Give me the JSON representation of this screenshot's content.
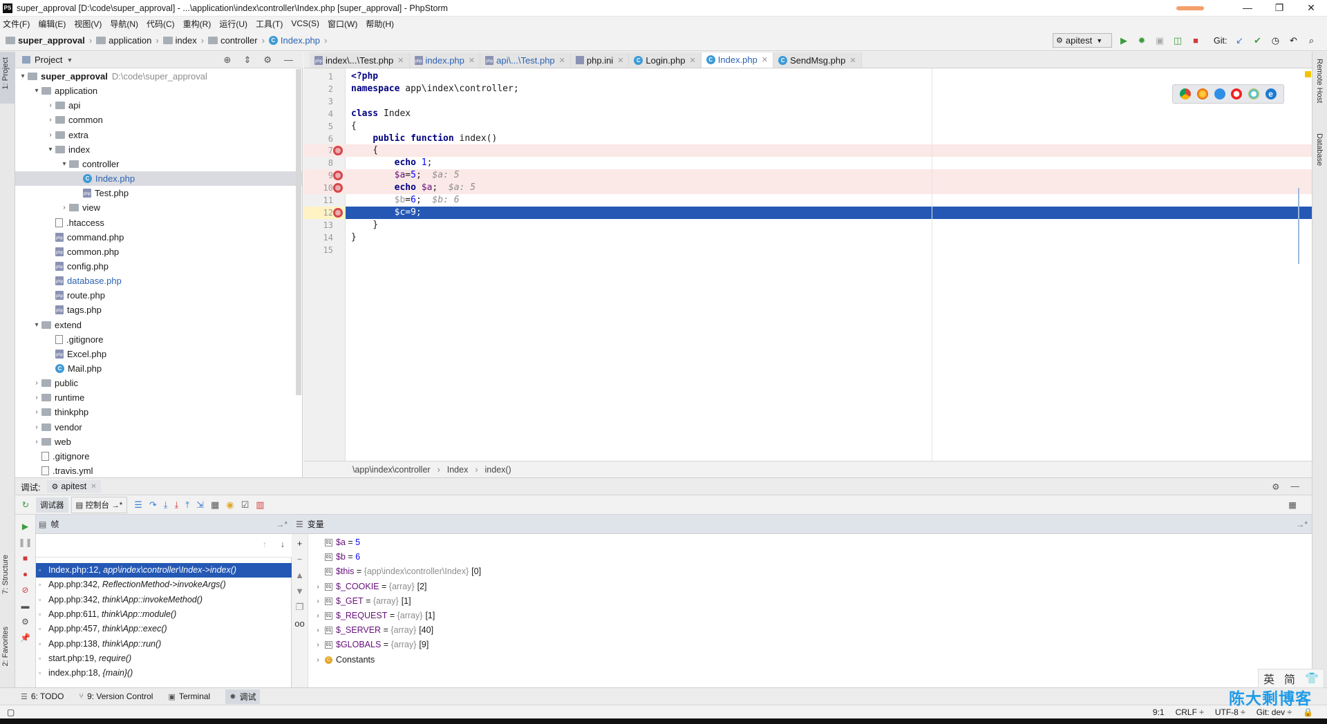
{
  "window": {
    "title": "super_approval [D:\\code\\super_approval] - ...\\application\\index\\controller\\Index.php [super_approval] - PhpStorm",
    "logo": "PS",
    "controls": [
      "—",
      "❐",
      "✕"
    ]
  },
  "menu": [
    "文件(F)",
    "编辑(E)",
    "视图(V)",
    "导航(N)",
    "代码(C)",
    "重构(R)",
    "运行(U)",
    "工具(T)",
    "VCS(S)",
    "窗口(W)",
    "帮助(H)"
  ],
  "breadcrumbs": [
    "super_approval",
    "application",
    "index",
    "controller",
    "Index.php"
  ],
  "toolbar": {
    "run_config": "apitest",
    "git_label": "Git:"
  },
  "left_strip": {
    "project": "1: Project",
    "structure": "7: Structure",
    "favorites": "2: Favorites"
  },
  "right_strip": {
    "remote": "Remote Host",
    "database": "Database"
  },
  "project": {
    "title": "Project",
    "tree": [
      {
        "label": "super_approval",
        "path": "D:\\code\\super_approval",
        "indent": 0,
        "type": "folder",
        "arrow": "open",
        "bold": true
      },
      {
        "label": "application",
        "indent": 1,
        "type": "folder",
        "arrow": "open"
      },
      {
        "label": "api",
        "indent": 2,
        "type": "folder",
        "arrow": "closed"
      },
      {
        "label": "common",
        "indent": 2,
        "type": "folder",
        "arrow": "closed"
      },
      {
        "label": "extra",
        "indent": 2,
        "type": "folder",
        "arrow": "closed"
      },
      {
        "label": "index",
        "indent": 2,
        "type": "folder",
        "arrow": "open"
      },
      {
        "label": "controller",
        "indent": 3,
        "type": "folder",
        "arrow": "open"
      },
      {
        "label": "Index.php",
        "indent": 4,
        "type": "class",
        "selected": true,
        "blue": true
      },
      {
        "label": "Test.php",
        "indent": 4,
        "type": "php"
      },
      {
        "label": "view",
        "indent": 3,
        "type": "folder",
        "arrow": "closed"
      },
      {
        "label": ".htaccess",
        "indent": 2,
        "type": "file"
      },
      {
        "label": "command.php",
        "indent": 2,
        "type": "php"
      },
      {
        "label": "common.php",
        "indent": 2,
        "type": "php"
      },
      {
        "label": "config.php",
        "indent": 2,
        "type": "php"
      },
      {
        "label": "database.php",
        "indent": 2,
        "type": "php",
        "blue": true
      },
      {
        "label": "route.php",
        "indent": 2,
        "type": "php"
      },
      {
        "label": "tags.php",
        "indent": 2,
        "type": "php"
      },
      {
        "label": "extend",
        "indent": 1,
        "type": "folder",
        "arrow": "open"
      },
      {
        "label": ".gitignore",
        "indent": 2,
        "type": "file"
      },
      {
        "label": "Excel.php",
        "indent": 2,
        "type": "php"
      },
      {
        "label": "Mail.php",
        "indent": 2,
        "type": "class"
      },
      {
        "label": "public",
        "indent": 1,
        "type": "folder",
        "arrow": "closed"
      },
      {
        "label": "runtime",
        "indent": 1,
        "type": "folder",
        "arrow": "closed"
      },
      {
        "label": "thinkphp",
        "indent": 1,
        "type": "folder",
        "arrow": "closed"
      },
      {
        "label": "vendor",
        "indent": 1,
        "type": "folder",
        "arrow": "closed"
      },
      {
        "label": "web",
        "indent": 1,
        "type": "folder",
        "arrow": "closed"
      },
      {
        "label": ".gitignore",
        "indent": 1,
        "type": "file"
      },
      {
        "label": ".travis.yml",
        "indent": 1,
        "type": "file"
      }
    ]
  },
  "tabs": [
    {
      "label": "index\\...\\Test.php",
      "type": "php"
    },
    {
      "label": "index.php",
      "type": "php",
      "blue": true
    },
    {
      "label": "api\\...\\Test.php",
      "type": "php",
      "blue": true
    },
    {
      "label": "php.ini",
      "type": "ini"
    },
    {
      "label": "Login.php",
      "type": "class"
    },
    {
      "label": "Index.php",
      "type": "class",
      "active": true,
      "blue": true
    },
    {
      "label": "SendMsg.php",
      "type": "class"
    }
  ],
  "code": [
    {
      "n": "1",
      "html": "<span class='kw'>&lt;?php</span>"
    },
    {
      "n": "2",
      "html": "<span class='kw'>namespace</span> app\\index\\controller;"
    },
    {
      "n": "3",
      "html": ""
    },
    {
      "n": "4",
      "html": "<span class='kw'>class</span> Index"
    },
    {
      "n": "5",
      "html": "{"
    },
    {
      "n": "6",
      "html": "    <span class='kw'>public function</span> index()"
    },
    {
      "n": "7",
      "html": "    {",
      "bp": true,
      "hl": "bp"
    },
    {
      "n": "8",
      "html": "        <span class='kw'>echo</span> <span class='num'>1</span>;"
    },
    {
      "n": "9",
      "html": "        <span class='var'>$a</span>=<span class='num'>5</span>;  <span class='hint'>$a: 5</span>",
      "bp": true,
      "hl": "bp"
    },
    {
      "n": "10",
      "html": "        <span class='kw'>echo</span> <span class='var'>$a</span>;  <span class='hint'>$a: 5</span>",
      "bp": true,
      "hl": "bp"
    },
    {
      "n": "11",
      "html": "        <span style='color:#999'>$b</span>=<span class='num'>6</span>;  <span class='hint'>$b: 6</span>"
    },
    {
      "n": "12",
      "html": "        $c=9;",
      "bp": true,
      "hl": "exec"
    },
    {
      "n": "13",
      "html": "    }"
    },
    {
      "n": "14",
      "html": "}"
    },
    {
      "n": "15",
      "html": ""
    }
  ],
  "editor_breadcrumb": [
    "\\app\\index\\controller",
    "Index",
    "index()"
  ],
  "debug": {
    "label": "调试:",
    "session": "apitest",
    "tab_debugger": "调试器",
    "tab_console": "控制台",
    "frames_title": "帧",
    "vars_title": "变量",
    "frames": [
      {
        "file": "Index.php:12,",
        "fn": "app\\index\\controller\\Index->index()",
        "selected": true
      },
      {
        "file": "App.php:342,",
        "fn": "ReflectionMethod->invokeArgs()"
      },
      {
        "file": "App.php:342,",
        "fn": "think\\App::invokeMethod()"
      },
      {
        "file": "App.php:611,",
        "fn": "think\\App::module()"
      },
      {
        "file": "App.php:457,",
        "fn": "think\\App::exec()"
      },
      {
        "file": "App.php:138,",
        "fn": "think\\App::run()"
      },
      {
        "file": "start.php:19,",
        "fn": "require()"
      },
      {
        "file": "index.php:18,",
        "fn": "{main}()"
      }
    ],
    "variables": [
      {
        "name": "$a",
        "eq": " = ",
        "type": "",
        "value": "5",
        "expand": false
      },
      {
        "name": "$b",
        "eq": " = ",
        "type": "",
        "value": "6",
        "expand": false
      },
      {
        "name": "$this",
        "eq": " = ",
        "type": "{app\\index\\controller\\Index}",
        "value": "[0]",
        "expand": false
      },
      {
        "name": "$_COOKIE",
        "eq": " = ",
        "type": "{array}",
        "value": "[2]",
        "expand": true
      },
      {
        "name": "$_GET",
        "eq": " = ",
        "type": "{array}",
        "value": "[1]",
        "expand": true
      },
      {
        "name": "$_REQUEST",
        "eq": " = ",
        "type": "{array}",
        "value": "[1]",
        "expand": true
      },
      {
        "name": "$_SERVER",
        "eq": " = ",
        "type": "{array}",
        "value": "[40]",
        "expand": true
      },
      {
        "name": "$GLOBALS",
        "eq": " = ",
        "type": "{array}",
        "value": "[9]",
        "expand": true
      },
      {
        "name": "Constants",
        "eq": "",
        "type": "",
        "value": "",
        "expand": true,
        "const": true
      }
    ]
  },
  "bottom_tabs": [
    {
      "label": "6: TODO"
    },
    {
      "label": "9: Version Control"
    },
    {
      "label": "Terminal"
    },
    {
      "label": "调试",
      "active": true
    }
  ],
  "status": {
    "pos": "9:1",
    "crlf": "CRLF ÷",
    "enc": "UTF-8 ÷",
    "git": "Git: dev ÷"
  },
  "ime": {
    "a": "英",
    "b": "简"
  },
  "watermark": "陈大剩博客",
  "colors": {
    "selection": "#2458b4",
    "breakpoint": "#d6464a",
    "bp_line": "#fbe9e7"
  }
}
